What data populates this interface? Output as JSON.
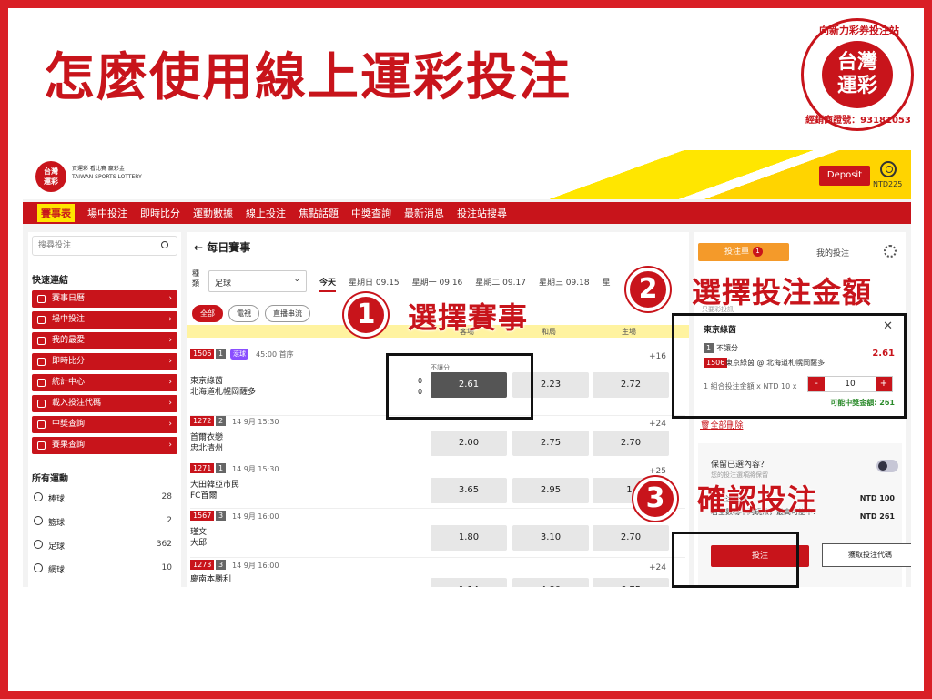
{
  "headline": "怎麼使用線上運彩投注",
  "seal": {
    "top": "向新力彩券投注站",
    "name1": "台灣",
    "name2": "運彩",
    "bottom": "經銷商證號：93181053"
  },
  "app": {
    "logo1": "台灣",
    "logo2": "運彩",
    "logo_slogan": "買運彩 看比賽 嬴彩金",
    "logo_en": "TAIWAN SPORTS LOTTERY",
    "deposit": "Deposit",
    "balance": "NTD225",
    "nav": [
      "賽事表",
      "場中投注",
      "即時比分",
      "運動數據",
      "線上投注",
      "焦點話題",
      "中獎查詢",
      "最新消息",
      "投注站搜尋"
    ],
    "search_placeholder": "搜尋投注",
    "quick_title": "快速連結",
    "quick": [
      "賽事日曆",
      "場中投注",
      "我的最愛",
      "即時比分",
      "統計中心",
      "載入投注代碼",
      "中獎查詢",
      "賽果查詢"
    ],
    "sports_title": "所有運動",
    "sports": [
      {
        "name": "棒球",
        "count": "28"
      },
      {
        "name": "籃球",
        "count": "2"
      },
      {
        "name": "足球",
        "count": "362"
      },
      {
        "name": "網球",
        "count": "10"
      }
    ],
    "main_title": "← 每日賽事",
    "filter_label": "種類",
    "filter_value": "足球",
    "days": [
      "今天",
      "星期日 09.15",
      "星期一 09.16",
      "星期二 09.17",
      "星期三 09.18",
      "星"
    ],
    "chips": [
      "全部",
      "電視",
      "直播串流"
    ],
    "cols": [
      "客場",
      "和局",
      "主場"
    ],
    "matches": [
      {
        "id": "1506",
        "n": "1",
        "tag": "滾球",
        "time": "45:00  首序",
        "t1": "東京綠茵",
        "t2": "北海道札幌岡薩多",
        "s1": "0",
        "s2": "0",
        "label": "不讓分",
        "o": [
          "2.61",
          "2.23",
          "2.72"
        ],
        "more": "+16"
      },
      {
        "id": "1272",
        "n": "2",
        "time": "14 9月  15:30",
        "t1": "首爾衣戀",
        "t2": "忠北清州",
        "o": [
          "2.00",
          "2.75",
          "2.70"
        ],
        "more": "+24"
      },
      {
        "id": "1271",
        "n": "1",
        "time": "14 9月  15:30",
        "t1": "大田韓亞市民",
        "t2": "FC首爾",
        "o": [
          "3.65",
          "2.95",
          "1."
        ],
        "more": "+25"
      },
      {
        "id": "1567",
        "n": "3",
        "time": "14 9月  16:00",
        "t1": "瑾文",
        "t2": "大邱",
        "o": [
          "1.80",
          "3.10",
          "2.70"
        ],
        "more": ""
      },
      {
        "id": "1273",
        "n": "3",
        "time": "14 9月  16:00",
        "t1": "慶南本勝利",
        "t2": "",
        "o": [
          "1.14",
          "4.80",
          "6.75"
        ],
        "more": "+24"
      }
    ],
    "slip_tab1": "投注單",
    "slip_badge": "1",
    "slip_tab2": "我的投注",
    "slip_sub": "只要彩投訊",
    "bet_team": "東京綠茵",
    "bet_n": "1",
    "bet_type": "不讓分",
    "bet_odd": "2.61",
    "bet_id": "1506",
    "bet_match": "東京綠茵 @ 北海道札幌岡薩多",
    "bet_label": "1 組合投注金額 x NTD 10 x",
    "stake": "10",
    "minus": "-",
    "plus": "+",
    "win_label": "可能中獎金額: 261",
    "clear_all": "全部刪除",
    "keep": "保留已選內容？",
    "keep_sub": "您的投注選項將保留",
    "total_label": "總投注金額",
    "total_value": "NTD 100",
    "max_label": "若全數為不同玩法，最高可能中:",
    "max_value": "NTD 261",
    "place": "投注",
    "get_code": "獲取投注代碼"
  },
  "steps": [
    {
      "n": "1",
      "text": "選擇賽事"
    },
    {
      "n": "2",
      "text": "選擇投注金額"
    },
    {
      "n": "3",
      "text": "確認投注"
    }
  ]
}
